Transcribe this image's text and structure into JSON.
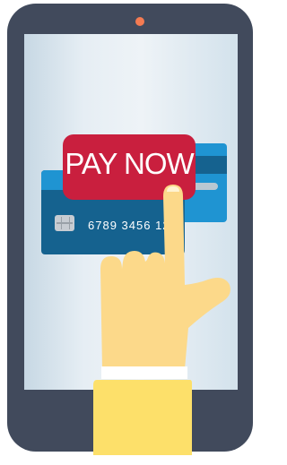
{
  "scene": {
    "pay_button_label": "PAY NOW",
    "card_number": "6789 3456 12",
    "colors": {
      "phone_body": "#414a5c",
      "camera": "#f47b52",
      "button": "#c91f3e",
      "card_light": "#1f94d2",
      "card_dark": "#15628f",
      "skin": "#fcd98a",
      "sleeve": "#fde06a"
    },
    "icons": [
      "card-chip-icon",
      "pointing-hand-icon"
    ]
  }
}
